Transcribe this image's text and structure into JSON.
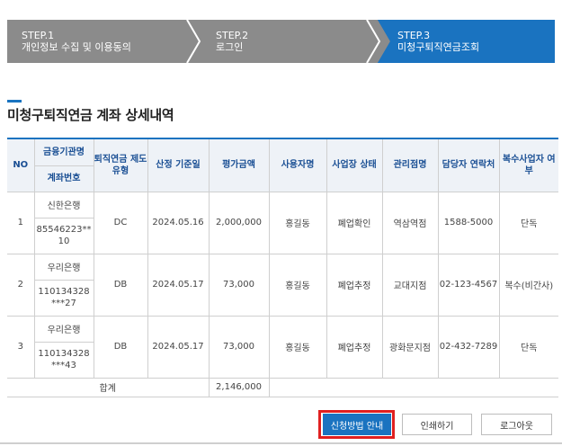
{
  "steps": [
    {
      "label": "STEP.1",
      "text": "개인정보 수집 및 이용동의"
    },
    {
      "label": "STEP.2",
      "text": "로그인"
    },
    {
      "label": "STEP.3",
      "text": "미청구퇴직연금조회"
    }
  ],
  "colors": {
    "active_step": "#1a73c0",
    "inactive_step": "#8b8b8b",
    "header_bg": "#eef2f7",
    "highlight": "#e02020"
  },
  "section_title": "미청구퇴직연금 계좌 상세내역",
  "table": {
    "headers": {
      "no": "NO",
      "institution": "금융기관명",
      "account": "계좌번호",
      "plan_type": "퇴직연금 제도유형",
      "calc_date": "산정 기준일",
      "amount": "평가금액",
      "employer": "사용자명",
      "status": "사업장 상태",
      "branch": "관리점명",
      "contact": "담당자 연락처",
      "multi": "복수사업자 여부"
    },
    "rows": [
      {
        "no": "1",
        "institution": "신한은행",
        "account": "85546223**10",
        "plan_type": "DC",
        "calc_date": "2024.05.16",
        "amount": "2,000,000",
        "employer": "홍길동",
        "status": "폐업확인",
        "branch": "역삼역점",
        "contact": "1588-5000",
        "multi": "단독"
      },
      {
        "no": "2",
        "institution": "우리은행",
        "account": "110134328***27",
        "plan_type": "DB",
        "calc_date": "2024.05.17",
        "amount": "73,000",
        "employer": "홍길동",
        "status": "폐업추정",
        "branch": "교대지점",
        "contact": "02-123-4567",
        "multi": "복수(비간사)"
      },
      {
        "no": "3",
        "institution": "우리은행",
        "account": "110134328***43",
        "plan_type": "DB",
        "calc_date": "2024.05.17",
        "amount": "73,000",
        "employer": "홍길동",
        "status": "폐업추정",
        "branch": "광화문지점",
        "contact": "02-432-7289",
        "multi": "단독"
      }
    ],
    "total_label": "합계",
    "total_amount": "2,146,000"
  },
  "buttons": {
    "apply_guide": "신청방법 안내",
    "print": "인쇄하기",
    "logout": "로그아웃"
  }
}
